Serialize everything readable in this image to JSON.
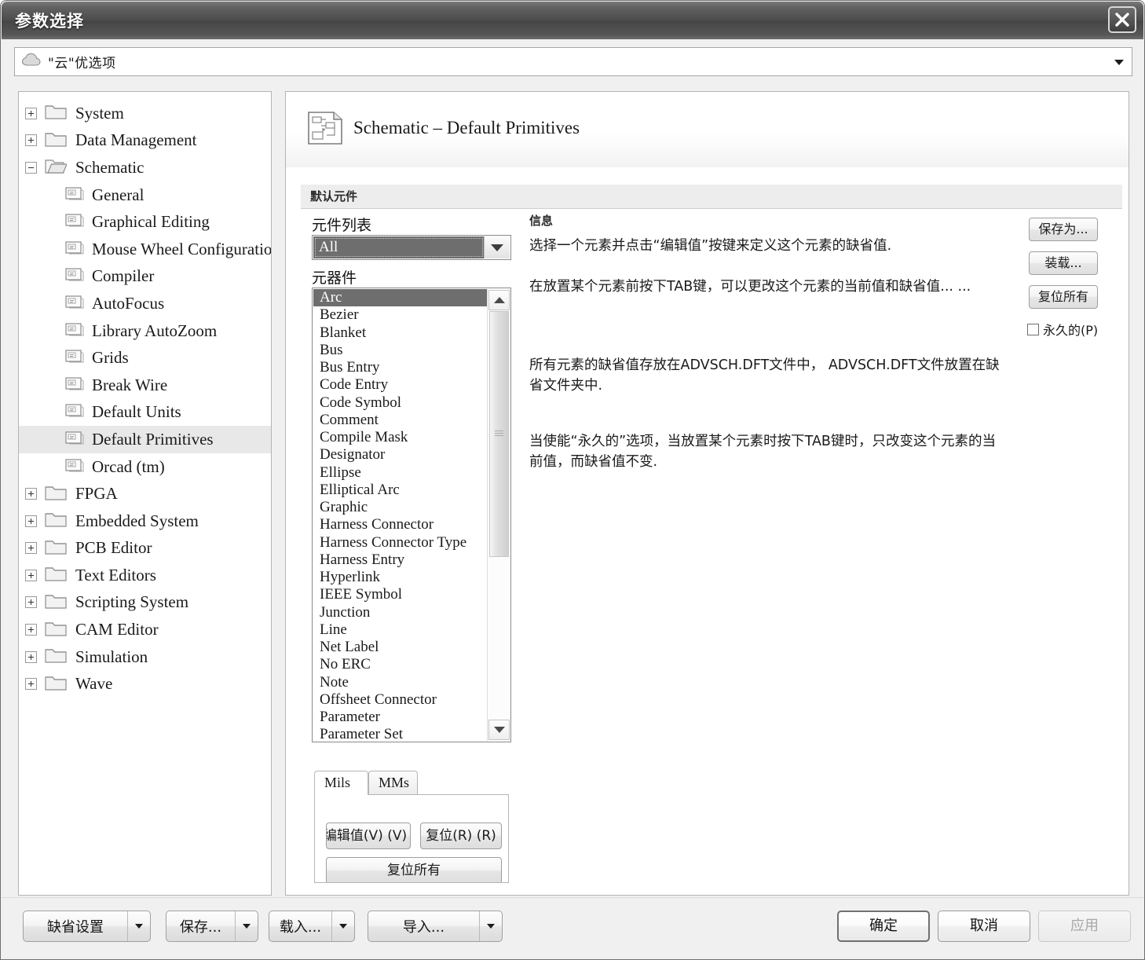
{
  "window": {
    "title": "参数选择",
    "close_label": "×"
  },
  "top_combo": {
    "icon": "cloud-icon",
    "value": "\"云\"优选项"
  },
  "tree": {
    "items": [
      {
        "label": "System",
        "icon": "folder-icon",
        "expander": "plus",
        "level": 1,
        "selected": false
      },
      {
        "label": "Data Management",
        "icon": "folder-icon",
        "expander": "plus",
        "level": 1,
        "selected": false
      },
      {
        "label": "Schematic",
        "icon": "folder-open-icon",
        "expander": "minus",
        "level": 1,
        "selected": false
      },
      {
        "label": "General",
        "icon": "page-icon",
        "expander": "none",
        "level": 2,
        "selected": false
      },
      {
        "label": "Graphical Editing",
        "icon": "page-icon",
        "expander": "none",
        "level": 2,
        "selected": false
      },
      {
        "label": "Mouse Wheel Configuration",
        "icon": "page-icon",
        "expander": "none",
        "level": 2,
        "selected": false
      },
      {
        "label": "Compiler",
        "icon": "page-icon",
        "expander": "none",
        "level": 2,
        "selected": false
      },
      {
        "label": "AutoFocus",
        "icon": "page-icon",
        "expander": "none",
        "level": 2,
        "selected": false
      },
      {
        "label": "Library AutoZoom",
        "icon": "page-icon",
        "expander": "none",
        "level": 2,
        "selected": false
      },
      {
        "label": "Grids",
        "icon": "page-icon",
        "expander": "none",
        "level": 2,
        "selected": false
      },
      {
        "label": "Break Wire",
        "icon": "page-icon",
        "expander": "none",
        "level": 2,
        "selected": false
      },
      {
        "label": "Default Units",
        "icon": "page-icon",
        "expander": "none",
        "level": 2,
        "selected": false
      },
      {
        "label": "Default Primitives",
        "icon": "page-icon",
        "expander": "none",
        "level": 2,
        "selected": true
      },
      {
        "label": "Orcad (tm)",
        "icon": "page-icon",
        "expander": "none",
        "level": 2,
        "selected": false
      },
      {
        "label": "FPGA",
        "icon": "folder-icon",
        "expander": "plus",
        "level": 1,
        "selected": false
      },
      {
        "label": "Embedded System",
        "icon": "folder-icon",
        "expander": "plus",
        "level": 1,
        "selected": false
      },
      {
        "label": "PCB Editor",
        "icon": "folder-icon",
        "expander": "plus",
        "level": 1,
        "selected": false
      },
      {
        "label": "Text Editors",
        "icon": "folder-icon",
        "expander": "plus",
        "level": 1,
        "selected": false
      },
      {
        "label": "Scripting System",
        "icon": "folder-icon",
        "expander": "plus",
        "level": 1,
        "selected": false
      },
      {
        "label": "CAM Editor",
        "icon": "folder-icon",
        "expander": "plus",
        "level": 1,
        "selected": false
      },
      {
        "label": "Simulation",
        "icon": "folder-icon",
        "expander": "plus",
        "level": 1,
        "selected": false
      },
      {
        "label": "Wave",
        "icon": "folder-icon",
        "expander": "plus",
        "level": 1,
        "selected": false
      }
    ]
  },
  "page": {
    "icon": "schematic-sheet-icon",
    "title": "Schematic – Default Primitives",
    "group_label": "默认元件"
  },
  "primitive_list": {
    "list_label": "元件列表",
    "selected_filter": "All",
    "items_label": "元器件",
    "selected_item": "Arc",
    "items": [
      "Arc",
      "Bezier",
      "Blanket",
      "Bus",
      "Bus Entry",
      "Code Entry",
      "Code Symbol",
      "Comment",
      "Compile Mask",
      "Designator",
      "Ellipse",
      "Elliptical Arc",
      "Graphic",
      "Harness Connector",
      "Harness Connector Type",
      "Harness Entry",
      "Hyperlink",
      "IEEE Symbol",
      "Junction",
      "Line",
      "Net Label",
      "No ERC",
      "Note",
      "Offsheet Connector",
      "Parameter",
      "Parameter Set"
    ]
  },
  "units_tabs": {
    "tabs": [
      {
        "label": "Mils",
        "active": true
      },
      {
        "label": "MMs",
        "active": false
      }
    ],
    "edit_value_label": "编辑值(V) (V)",
    "reset_label": "复位(R) (R)",
    "reset_all_label": "复位所有"
  },
  "info": {
    "heading": "信息",
    "paragraph_1": "选择一个元素并点击“编辑值”按键来定义这个元素的缺省值.",
    "paragraph_2": "在放置某个元素前按下TAB键，可以更改这个元素的当前值和缺省值... ...",
    "paragraph_3": "所有元素的缺省值存放在ADVSCH.DFT文件中， ADVSCH.DFT文件放置在缺省文件夹中.",
    "paragraph_4": "当使能“永久的”选项，当放置某个元素时按下TAB键时，只改变这个元素的当前值，而缺省值不变."
  },
  "side_actions": {
    "save_as_label": "保存为...",
    "load_label": "装载...",
    "reset_all_label": "复位所有",
    "permanent_label": "永久的(P)",
    "permanent_checked": false
  },
  "footer": {
    "left_buttons": [
      {
        "label": "缺省设置"
      },
      {
        "label": "保存..."
      },
      {
        "label": "载入..."
      },
      {
        "label": "导入..."
      }
    ],
    "ok_label": "确定",
    "cancel_label": "取消",
    "apply_label": "应用",
    "apply_enabled": false
  },
  "colors": {
    "titlebar": "#4d4d4d",
    "dialog_bg": "#f0f0f0",
    "selection": "#6e6e6e",
    "tree_selection": "#e8e8e8",
    "panel_border": "#b4b4b4"
  }
}
